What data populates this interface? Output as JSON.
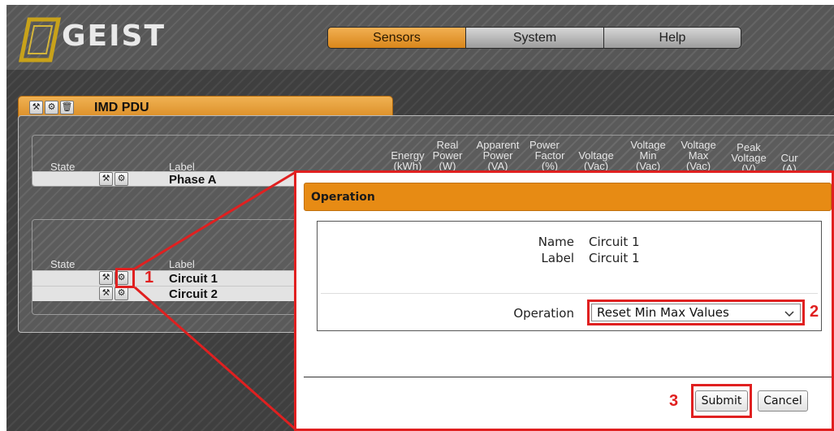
{
  "brand": {
    "name": "GEIST"
  },
  "nav": {
    "tabs": [
      {
        "label": "Sensors"
      },
      {
        "label": "System"
      },
      {
        "label": "Help"
      }
    ],
    "active": "Sensors"
  },
  "device": {
    "title": "IMD PDU",
    "phase_table": {
      "state_header": "State",
      "label_header": "Label",
      "columns": [
        {
          "line1": "",
          "line2": "Energy",
          "line3": "(kWh)"
        },
        {
          "line1": "Real",
          "line2": "Power",
          "line3": "(W)"
        },
        {
          "line1": "Apparent",
          "line2": "Power",
          "line3": "(VA)"
        },
        {
          "line1": "Power",
          "line2": "Factor",
          "line3": "(%)"
        },
        {
          "line1": "",
          "line2": "Voltage",
          "line3": "(Vac)"
        },
        {
          "line1": "Voltage",
          "line2": "Min",
          "line3": "(Vac)"
        },
        {
          "line1": "Voltage",
          "line2": "Max",
          "line3": "(Vac)"
        },
        {
          "line1": "Peak",
          "line2": "Voltage",
          "line3": "(V)"
        },
        {
          "line1": "",
          "line2": "Cur",
          "line3": "(A)"
        }
      ],
      "rows": [
        {
          "label": "Phase A"
        }
      ]
    },
    "circuit_table": {
      "state_header": "State",
      "label_header": "Label",
      "rows": [
        {
          "label": "Circuit 1"
        },
        {
          "label": "Circuit 2"
        }
      ]
    }
  },
  "dialog": {
    "title": "Operation",
    "name_label": "Name",
    "name_value": "Circuit 1",
    "label_label": "Label",
    "label_value": "Circuit 1",
    "operation_label": "Operation",
    "operation_selected": "Reset Min Max Values",
    "submit_label": "Submit",
    "cancel_label": "Cancel"
  },
  "callouts": {
    "step1": "1",
    "step2": "2",
    "step3": "3"
  },
  "colors": {
    "accent": "#e78b14",
    "highlight": "#e02020",
    "dark_bg": "#3f3f3f"
  },
  "icons": [
    "wrench-icon",
    "gear-icon",
    "trash-icon",
    "chevron-down-icon",
    "geist-logo-icon"
  ]
}
